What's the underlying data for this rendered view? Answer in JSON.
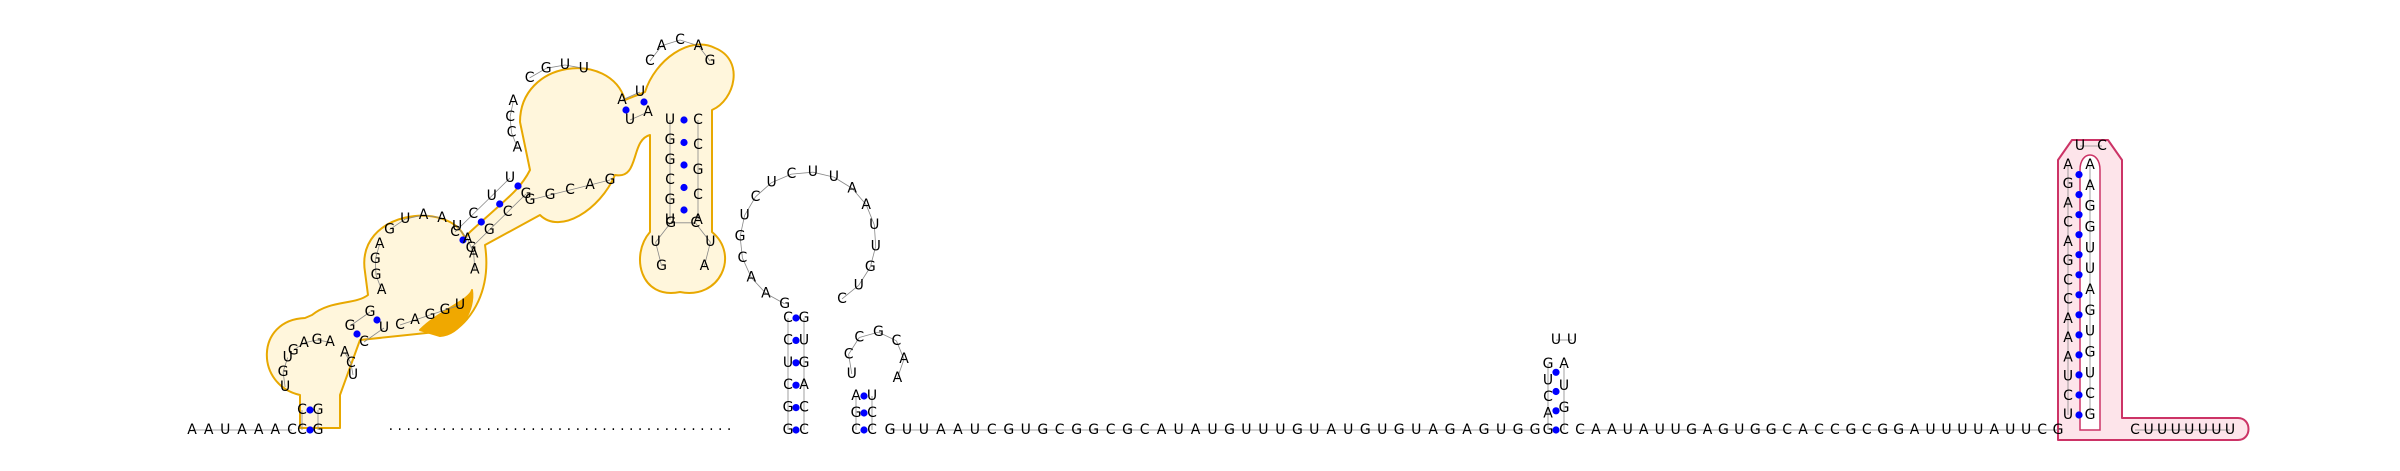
{
  "diagram": {
    "type": "RNA secondary structure",
    "colors": {
      "pair_dot": "#0000ff",
      "link": "#888888",
      "highlight_outline": "#e8a800",
      "highlight_fill": "#fff6dc",
      "highlight_accent": "#f0a800",
      "pink_outline": "#cc3366",
      "pink_fill": "#fde4ea"
    },
    "tail_left": "A A U A A A C",
    "left_hairpin": {
      "stem_left": "C C",
      "stem_right": "G G",
      "loop_left": "U G U",
      "loop_top": "G A G A",
      "loop_right": "A C U"
    },
    "left_upper": {
      "stem_left": "G G",
      "stem_right": "C U",
      "loop_left": "A G G A",
      "loop_top": "G U A A",
      "loop_right": "U A A A",
      "accent": "C A G G U"
    },
    "left_branch": {
      "stem_left": "C C U U",
      "stem_right": "G G C G",
      "loop_left": "A C C A",
      "loop_top": "C G U U",
      "loop_right": "G A C G G",
      "top_stem_left": "A U",
      "top_stem_right": "U A",
      "hp_top": "C A C A G",
      "hp_stem_left": "U G G C G U",
      "hp_stem_right": "C C G C A",
      "hp_loop": "G U G C U A"
    },
    "middle_region": {
      "dots": "· · · · · · · · · · · · · · · · · · · · · · · · · · · · · · · · · · · · · · ·",
      "stem_a_left": "G G C U C C",
      "stem_a_right": "C C A G U G",
      "loop_a": "G A A C G U C U C U U A A U U G U C",
      "stem_b_left": "C G A",
      "stem_b_right": "C C U",
      "loop_b": "U C C G C A A"
    },
    "long_run": "G U U A A U C G U G C G G C G C A U A U G U U U G U A U G U G U A G A G U G G",
    "small_hairpin": {
      "stem_left": "G A C U G",
      "stem_right": "C G U A",
      "loop": "U U"
    },
    "run_after_small": "C A A U A U U G A G U G G C A C C G C G G A U U U U A U U C G",
    "right_hairpin": {
      "stem_left": "U C U A A A C C G A C A G A",
      "stem_right": "G C U G U G A U U G G A A",
      "loop": "U C"
    },
    "tail_right": "C U U U U U U U"
  }
}
